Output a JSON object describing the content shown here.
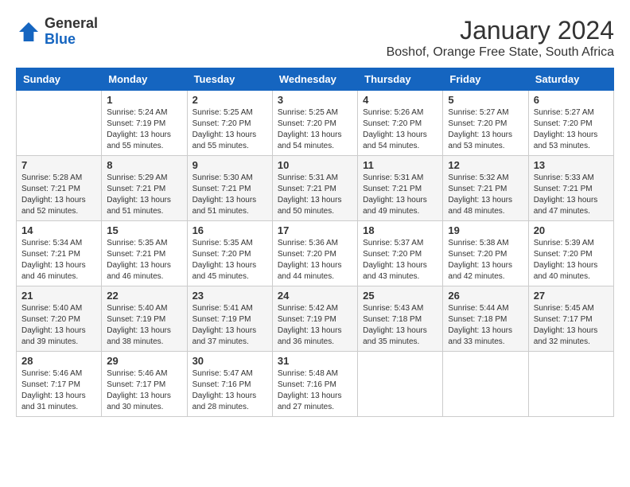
{
  "logo": {
    "general": "General",
    "blue": "Blue"
  },
  "title": "January 2024",
  "subtitle": "Boshof, Orange Free State, South Africa",
  "days_of_week": [
    "Sunday",
    "Monday",
    "Tuesday",
    "Wednesday",
    "Thursday",
    "Friday",
    "Saturday"
  ],
  "weeks": [
    [
      {
        "day": "",
        "sunrise": "",
        "sunset": "",
        "daylight": ""
      },
      {
        "day": "1",
        "sunrise": "Sunrise: 5:24 AM",
        "sunset": "Sunset: 7:19 PM",
        "daylight": "Daylight: 13 hours and 55 minutes."
      },
      {
        "day": "2",
        "sunrise": "Sunrise: 5:25 AM",
        "sunset": "Sunset: 7:20 PM",
        "daylight": "Daylight: 13 hours and 55 minutes."
      },
      {
        "day": "3",
        "sunrise": "Sunrise: 5:25 AM",
        "sunset": "Sunset: 7:20 PM",
        "daylight": "Daylight: 13 hours and 54 minutes."
      },
      {
        "day": "4",
        "sunrise": "Sunrise: 5:26 AM",
        "sunset": "Sunset: 7:20 PM",
        "daylight": "Daylight: 13 hours and 54 minutes."
      },
      {
        "day": "5",
        "sunrise": "Sunrise: 5:27 AM",
        "sunset": "Sunset: 7:20 PM",
        "daylight": "Daylight: 13 hours and 53 minutes."
      },
      {
        "day": "6",
        "sunrise": "Sunrise: 5:27 AM",
        "sunset": "Sunset: 7:20 PM",
        "daylight": "Daylight: 13 hours and 53 minutes."
      }
    ],
    [
      {
        "day": "7",
        "sunrise": "Sunrise: 5:28 AM",
        "sunset": "Sunset: 7:21 PM",
        "daylight": "Daylight: 13 hours and 52 minutes."
      },
      {
        "day": "8",
        "sunrise": "Sunrise: 5:29 AM",
        "sunset": "Sunset: 7:21 PM",
        "daylight": "Daylight: 13 hours and 51 minutes."
      },
      {
        "day": "9",
        "sunrise": "Sunrise: 5:30 AM",
        "sunset": "Sunset: 7:21 PM",
        "daylight": "Daylight: 13 hours and 51 minutes."
      },
      {
        "day": "10",
        "sunrise": "Sunrise: 5:31 AM",
        "sunset": "Sunset: 7:21 PM",
        "daylight": "Daylight: 13 hours and 50 minutes."
      },
      {
        "day": "11",
        "sunrise": "Sunrise: 5:31 AM",
        "sunset": "Sunset: 7:21 PM",
        "daylight": "Daylight: 13 hours and 49 minutes."
      },
      {
        "day": "12",
        "sunrise": "Sunrise: 5:32 AM",
        "sunset": "Sunset: 7:21 PM",
        "daylight": "Daylight: 13 hours and 48 minutes."
      },
      {
        "day": "13",
        "sunrise": "Sunrise: 5:33 AM",
        "sunset": "Sunset: 7:21 PM",
        "daylight": "Daylight: 13 hours and 47 minutes."
      }
    ],
    [
      {
        "day": "14",
        "sunrise": "Sunrise: 5:34 AM",
        "sunset": "Sunset: 7:21 PM",
        "daylight": "Daylight: 13 hours and 46 minutes."
      },
      {
        "day": "15",
        "sunrise": "Sunrise: 5:35 AM",
        "sunset": "Sunset: 7:21 PM",
        "daylight": "Daylight: 13 hours and 46 minutes."
      },
      {
        "day": "16",
        "sunrise": "Sunrise: 5:35 AM",
        "sunset": "Sunset: 7:20 PM",
        "daylight": "Daylight: 13 hours and 45 minutes."
      },
      {
        "day": "17",
        "sunrise": "Sunrise: 5:36 AM",
        "sunset": "Sunset: 7:20 PM",
        "daylight": "Daylight: 13 hours and 44 minutes."
      },
      {
        "day": "18",
        "sunrise": "Sunrise: 5:37 AM",
        "sunset": "Sunset: 7:20 PM",
        "daylight": "Daylight: 13 hours and 43 minutes."
      },
      {
        "day": "19",
        "sunrise": "Sunrise: 5:38 AM",
        "sunset": "Sunset: 7:20 PM",
        "daylight": "Daylight: 13 hours and 42 minutes."
      },
      {
        "day": "20",
        "sunrise": "Sunrise: 5:39 AM",
        "sunset": "Sunset: 7:20 PM",
        "daylight": "Daylight: 13 hours and 40 minutes."
      }
    ],
    [
      {
        "day": "21",
        "sunrise": "Sunrise: 5:40 AM",
        "sunset": "Sunset: 7:20 PM",
        "daylight": "Daylight: 13 hours and 39 minutes."
      },
      {
        "day": "22",
        "sunrise": "Sunrise: 5:40 AM",
        "sunset": "Sunset: 7:19 PM",
        "daylight": "Daylight: 13 hours and 38 minutes."
      },
      {
        "day": "23",
        "sunrise": "Sunrise: 5:41 AM",
        "sunset": "Sunset: 7:19 PM",
        "daylight": "Daylight: 13 hours and 37 minutes."
      },
      {
        "day": "24",
        "sunrise": "Sunrise: 5:42 AM",
        "sunset": "Sunset: 7:19 PM",
        "daylight": "Daylight: 13 hours and 36 minutes."
      },
      {
        "day": "25",
        "sunrise": "Sunrise: 5:43 AM",
        "sunset": "Sunset: 7:18 PM",
        "daylight": "Daylight: 13 hours and 35 minutes."
      },
      {
        "day": "26",
        "sunrise": "Sunrise: 5:44 AM",
        "sunset": "Sunset: 7:18 PM",
        "daylight": "Daylight: 13 hours and 33 minutes."
      },
      {
        "day": "27",
        "sunrise": "Sunrise: 5:45 AM",
        "sunset": "Sunset: 7:17 PM",
        "daylight": "Daylight: 13 hours and 32 minutes."
      }
    ],
    [
      {
        "day": "28",
        "sunrise": "Sunrise: 5:46 AM",
        "sunset": "Sunset: 7:17 PM",
        "daylight": "Daylight: 13 hours and 31 minutes."
      },
      {
        "day": "29",
        "sunrise": "Sunrise: 5:46 AM",
        "sunset": "Sunset: 7:17 PM",
        "daylight": "Daylight: 13 hours and 30 minutes."
      },
      {
        "day": "30",
        "sunrise": "Sunrise: 5:47 AM",
        "sunset": "Sunset: 7:16 PM",
        "daylight": "Daylight: 13 hours and 28 minutes."
      },
      {
        "day": "31",
        "sunrise": "Sunrise: 5:48 AM",
        "sunset": "Sunset: 7:16 PM",
        "daylight": "Daylight: 13 hours and 27 minutes."
      },
      {
        "day": "",
        "sunrise": "",
        "sunset": "",
        "daylight": ""
      },
      {
        "day": "",
        "sunrise": "",
        "sunset": "",
        "daylight": ""
      },
      {
        "day": "",
        "sunrise": "",
        "sunset": "",
        "daylight": ""
      }
    ]
  ],
  "colors": {
    "header_bg": "#1565c0",
    "header_text": "#ffffff",
    "border": "#cccccc",
    "row_even_bg": "#f5f5f5",
    "row_odd_bg": "#ffffff"
  }
}
